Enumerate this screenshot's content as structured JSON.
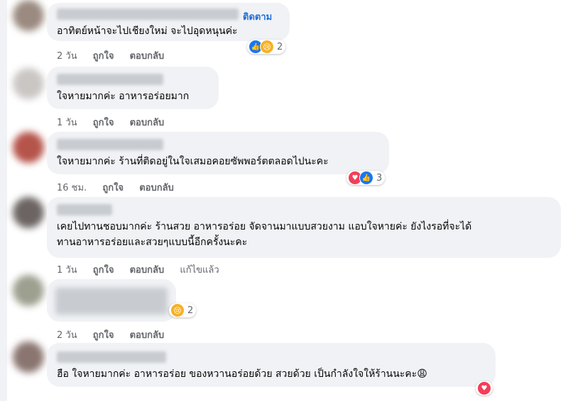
{
  "comments": [
    {
      "follow_label": "ติดตาม",
      "text": "อาทิตย์หน้าจะไปเชียงใหม่ จะไปอุดหนุนค่ะ",
      "time": "2 วัน",
      "like": "ถูกใจ",
      "reply": "ตอบกลับ",
      "reaction_count": "2",
      "reactions": [
        "like-icon",
        "sad-icon"
      ],
      "avatar_color": "#9a8a80"
    },
    {
      "text": "ใจหายมากค่ะ อาหารอร่อยมาก",
      "time": "1 วัน",
      "like": "ถูกใจ",
      "reply": "ตอบกลับ",
      "avatar_color": "#c9c6c4"
    },
    {
      "text": "ใจหายมากค่ะ ร้านที่ติดอยู่ในใจเสมอคอยซัพพอร์ตตลอดไปนะคะ",
      "time": "16 ชม.",
      "like": "ถูกใจ",
      "reply": "ตอบกลับ",
      "reaction_count": "3",
      "reactions": [
        "love-icon",
        "like-icon"
      ],
      "avatar_color": "#b5544a"
    },
    {
      "text_line1": "เคยไปทานชอบมากค่ะ ร้านสวย อาหารอร่อย จัดจานมาแบบสวยงาม แอบใจหายค่ะ ยังไงรอที่จะได้",
      "text_line2": "ทานอาหารอร่อยและสวยๆแบบนี้อีกครั้งนะคะ",
      "time": "1 วัน",
      "like": "ถูกใจ",
      "reply": "ตอบกลับ",
      "edited": "แก้ไขแล้ว",
      "avatar_color": "#6b6462"
    },
    {
      "time": "2 วัน",
      "like": "ถูกใจ",
      "reply": "ตอบกลับ",
      "reaction_count": "2",
      "reactions": [
        "sad-icon"
      ],
      "avatar_color": "#9da08f"
    },
    {
      "text": "ฮือ ใจหายมากค่ะ อาหารอร่อย ของหวานอร่อยด้วย สวยด้วย เป็นกำลังใจให้ร้านนะคะ😩",
      "reactions": [
        "love-icon"
      ],
      "avatar_color": "#8a7570"
    }
  ]
}
